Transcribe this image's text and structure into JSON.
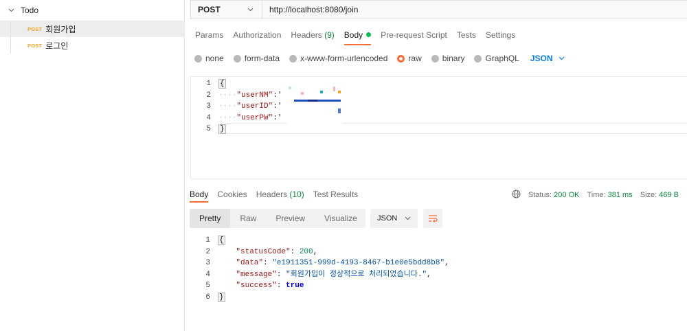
{
  "sidebar": {
    "collection": "Todo",
    "items": [
      {
        "method": "POST",
        "name": "회원가입"
      },
      {
        "method": "POST",
        "name": "로그인"
      }
    ]
  },
  "request": {
    "method": "POST",
    "url": "http://localhost:8080/join",
    "tabs": [
      {
        "label": "Params"
      },
      {
        "label": "Authorization"
      },
      {
        "label": "Headers",
        "count": "(9)"
      },
      {
        "label": "Body"
      },
      {
        "label": "Pre-request Script"
      },
      {
        "label": "Tests"
      },
      {
        "label": "Settings"
      }
    ],
    "body_types": [
      "none",
      "form-data",
      "x-www-form-urlencoded",
      "raw",
      "binary",
      "GraphQL"
    ],
    "language": "JSON",
    "lines": [
      {
        "n": "1",
        "text": "{"
      },
      {
        "n": "2",
        "key": "\"userNM\"",
        "text": ":'"
      },
      {
        "n": "3",
        "key": "\"userID\"",
        "text": ":'"
      },
      {
        "n": "4",
        "key": "\"userPW\"",
        "text": ":'"
      },
      {
        "n": "5",
        "text": "}"
      }
    ]
  },
  "response": {
    "tabs": [
      {
        "label": "Body"
      },
      {
        "label": "Cookies"
      },
      {
        "label": "Headers",
        "count": "(10)"
      },
      {
        "label": "Test Results"
      }
    ],
    "status_label": "Status:",
    "status_value": "200 OK",
    "time_label": "Time:",
    "time_value": "381 ms",
    "size_label": "Size:",
    "size_value": "469 B",
    "views": [
      "Pretty",
      "Raw",
      "Preview",
      "Visualize"
    ],
    "format": "JSON",
    "lines": {
      "l1": "{",
      "statusCode_key": "\"statusCode\"",
      "statusCode_val": "200",
      "data_key": "\"data\"",
      "data_val": "\"e1911351-999d-4193-8467-b1e0e5bdd8b8\"",
      "message_key": "\"message\"",
      "message_val": "\"회원가입이 정상적으로 처리되었습니다.\"",
      "success_key": "\"success\"",
      "success_val": "true",
      "l6": "}"
    }
  },
  "colors": {
    "accent": "#ff6c37",
    "post_badge": "#f5a623",
    "status_green": "#0b8a3b",
    "json_blue": "#097bed"
  }
}
